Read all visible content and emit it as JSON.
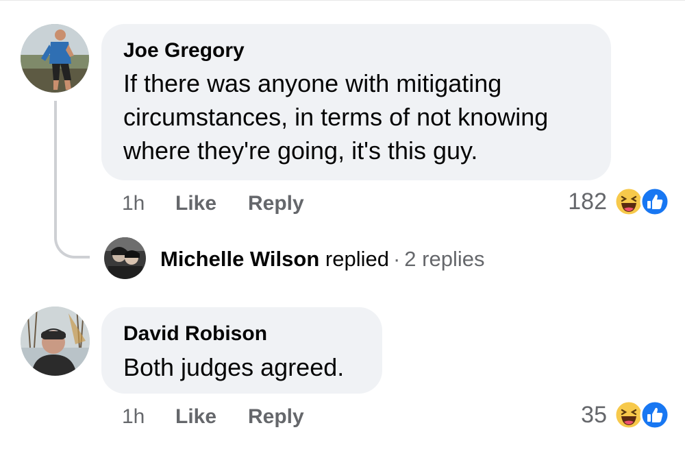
{
  "comments": [
    {
      "author": "Joe Gregory",
      "text_lines": [
        "If there was anyone with mitigating",
        "circumstances, in terms of not knowing",
        "where they're going, it's this guy."
      ],
      "time": "1h",
      "like_label": "Like",
      "reply_label": "Reply",
      "reaction_count": "182",
      "reactions": [
        "haha-icon",
        "like-icon"
      ],
      "replies_preview": {
        "name": "Michelle Wilson",
        "verb": "replied",
        "separator": "·",
        "count_text": "2 replies"
      }
    },
    {
      "author": "David Robison",
      "text_lines": [
        "Both judges agreed."
      ],
      "time": "1h",
      "like_label": "Like",
      "reply_label": "Reply",
      "reaction_count": "35",
      "reactions": [
        "haha-icon",
        "like-icon"
      ]
    }
  ],
  "colors": {
    "bubble": "#f0f2f5",
    "secondary_text": "#65676b",
    "primary_text": "#050505",
    "like_blue": "#1877f2",
    "haha_yellow": "#f7c94b"
  }
}
